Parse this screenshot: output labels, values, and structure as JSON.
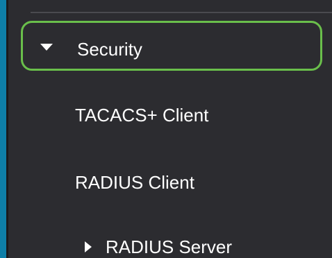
{
  "sidebar": {
    "section": {
      "label": "Security",
      "expanded": true,
      "highlight_color": "#6abf4b"
    },
    "items": [
      {
        "label": "TACACS+ Client"
      },
      {
        "label": "RADIUS Client"
      },
      {
        "label": "RADIUS Server",
        "collapsible": true,
        "expanded": false
      }
    ]
  },
  "colors": {
    "background": "#2c2c30",
    "accent": "#0e7fa8",
    "text": "#ffffff"
  },
  "icons": {
    "section_toggle": "caret-down-icon",
    "radius_server_toggle": "caret-right-icon"
  }
}
